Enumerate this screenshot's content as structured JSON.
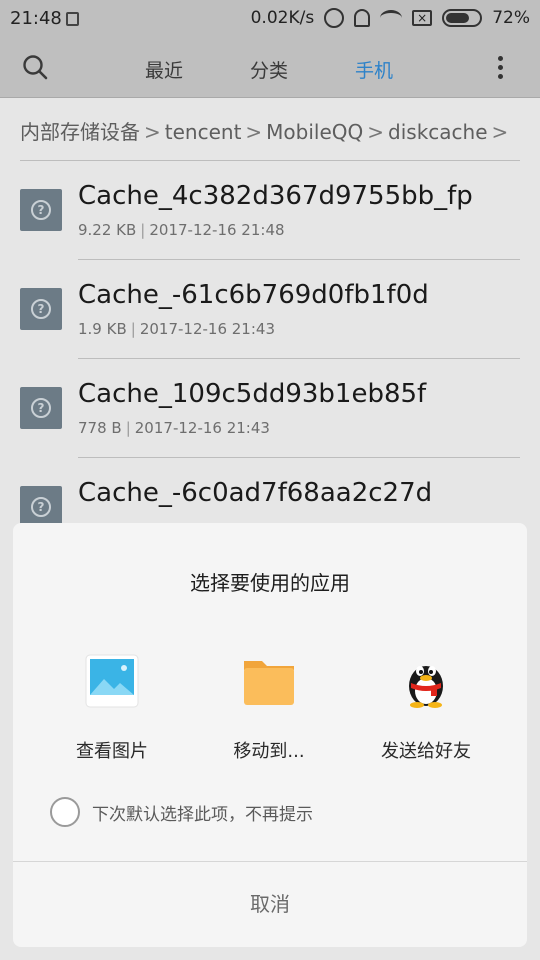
{
  "status_bar": {
    "time": "21:48",
    "network_speed": "0.02K/s",
    "battery": "72%",
    "battery_level": 0.72
  },
  "toolbar": {
    "search_icon": "search-icon",
    "tabs": [
      {
        "label": "最近",
        "active": false
      },
      {
        "label": "分类",
        "active": false
      },
      {
        "label": "手机",
        "active": true
      }
    ],
    "more_icon": "more-vertical-icon",
    "accent_color": "#2d82c9"
  },
  "breadcrumb": {
    "items": [
      "内部存储设备",
      "tencent",
      "MobileQQ",
      "diskcache"
    ],
    "separator": ">"
  },
  "files": [
    {
      "name": "Cache_4c382d367d9755bb_fp",
      "size": "9.22 KB",
      "date": "2017-12-16 21:48"
    },
    {
      "name": "Cache_-61c6b769d0fb1f0d",
      "size": "1.9 KB",
      "date": "2017-12-16 21:43"
    },
    {
      "name": "Cache_109c5dd93b1eb85f",
      "size": "778 B",
      "date": "2017-12-16 21:43"
    },
    {
      "name": "Cache_-6c0ad7f68aa2c27d",
      "size": "",
      "date": ""
    }
  ],
  "dialog": {
    "title": "选择要使用的应用",
    "apps": [
      {
        "label": "查看图片",
        "icon": "image-viewer-icon"
      },
      {
        "label": "移动到...",
        "icon": "folder-icon"
      },
      {
        "label": "发送给好友",
        "icon": "qq-penguin-icon"
      }
    ],
    "remember_label": "下次默认选择此项，不再提示",
    "cancel_label": "取消"
  }
}
